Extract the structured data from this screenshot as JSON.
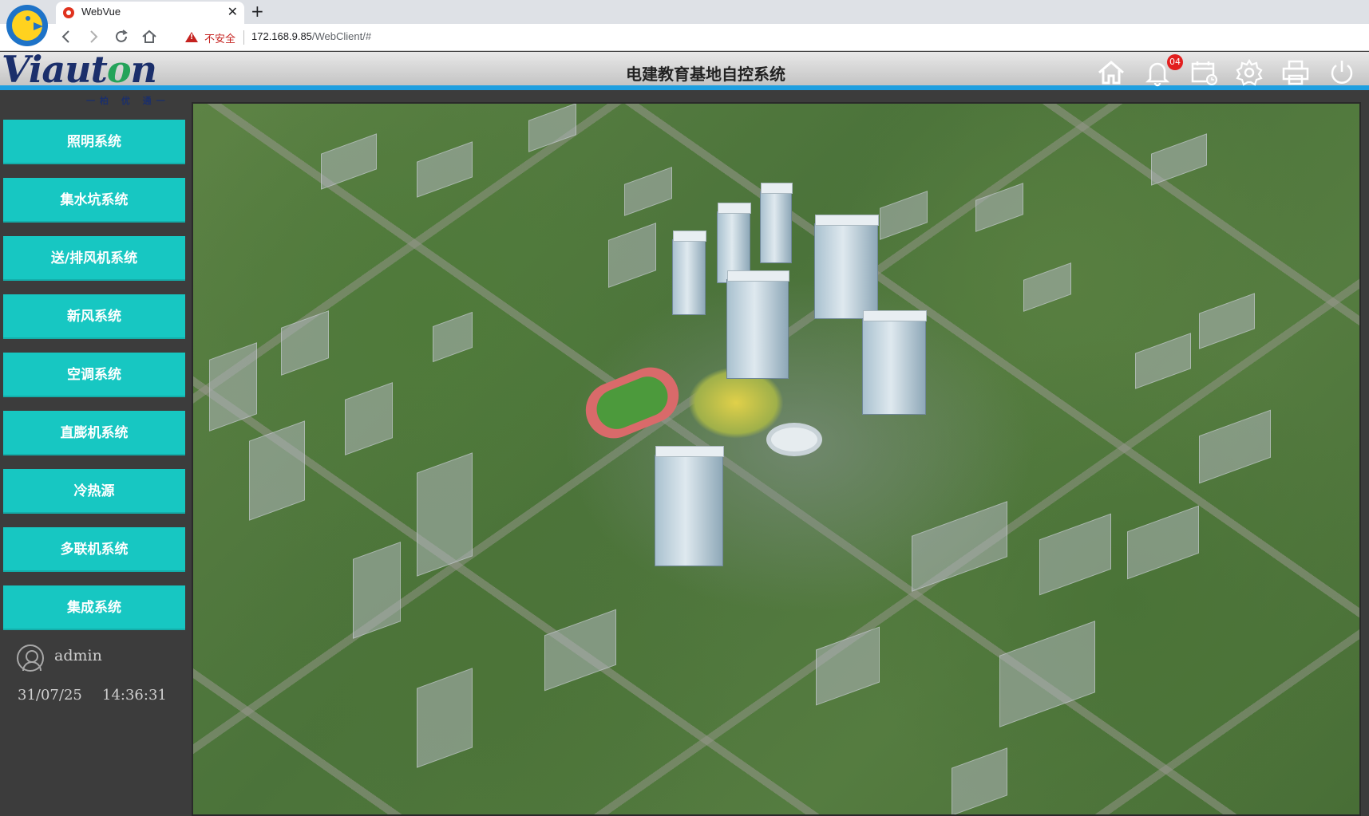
{
  "browser": {
    "tab_title": "WebVue",
    "tab_close": "✕",
    "new_tab": "+",
    "security_label": "不安全",
    "url_host": "172.168.9.85",
    "url_path": "/WebClient/#"
  },
  "header": {
    "brand_name_pre": "Viaut",
    "brand_name_o": "o",
    "brand_name_post": "n",
    "brand_slogan": "一柏 优 通一",
    "title": "电建教育基地自控系统",
    "alarm_count": "04"
  },
  "sidebar": {
    "menu": [
      {
        "label": "照明系统"
      },
      {
        "label": "集水坑系统"
      },
      {
        "label": "送/排风机系统"
      },
      {
        "label": "新风系统"
      },
      {
        "label": "空调系统"
      },
      {
        "label": "直膨机系统"
      },
      {
        "label": "冷热源"
      },
      {
        "label": "多联机系统"
      },
      {
        "label": "集成系统"
      }
    ],
    "user": {
      "name": "admin",
      "date": "31/07/25",
      "time": "14:36:31"
    }
  },
  "colors": {
    "menu_button": "#17c7c2",
    "header_accent": "#1e9fe0",
    "sidebar_bg": "#3c3c3c",
    "alarm_badge": "#e21f1f"
  },
  "icons": {
    "header": [
      "home-icon",
      "bell-icon",
      "calendar-clock-icon",
      "gear-icon",
      "printer-icon",
      "power-icon"
    ]
  }
}
